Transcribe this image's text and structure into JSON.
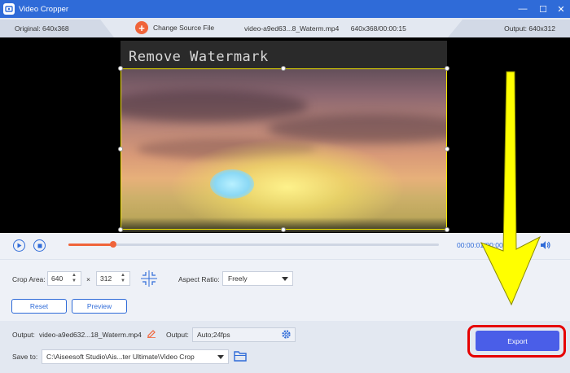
{
  "window": {
    "title": "Video Cropper",
    "minimize": "—",
    "maximize": "☐",
    "close": "✕"
  },
  "infobar": {
    "original": "Original: 640x368",
    "change_source": "Change Source File",
    "filename": "video-a9ed63...8_Waterm.mp4",
    "resolution_duration": "640x368/00:00:15",
    "output": "Output: 640x312"
  },
  "preview": {
    "watermark_text": "Remove Watermark"
  },
  "playback": {
    "progress": 0.12,
    "timecode": "00:00:01/00:00:15"
  },
  "crop": {
    "crop_area_label": "Crop Area:",
    "width": "640",
    "times": "×",
    "height": "312",
    "aspect_label": "Aspect Ratio:",
    "aspect_value": "Freely",
    "reset": "Reset",
    "preview": "Preview"
  },
  "output": {
    "output_label": "Output:",
    "output_file": "video-a9ed632...18_Waterm.mp4",
    "format_label": "Output:",
    "format_value": "Auto;24fps",
    "save_label": "Save to:",
    "save_path": "C:\\Aiseesoft Studio\\Ais...ter Ultimate\\Video Crop",
    "export": "Export"
  },
  "colors": {
    "accent": "#2f6bd8",
    "orange": "#f0643a",
    "export_bg": "#4a5ee8",
    "highlight_ring": "#e60000",
    "arrow": "#ffff00"
  },
  "icons": [
    "app-icon",
    "minimize-icon",
    "maximize-icon",
    "close-icon",
    "add-circle-icon",
    "play-icon",
    "stop-icon",
    "volume-icon",
    "center-crop-icon",
    "edit-pencil-icon",
    "settings-gear-icon",
    "dropdown-caret-icon",
    "folder-icon"
  ]
}
